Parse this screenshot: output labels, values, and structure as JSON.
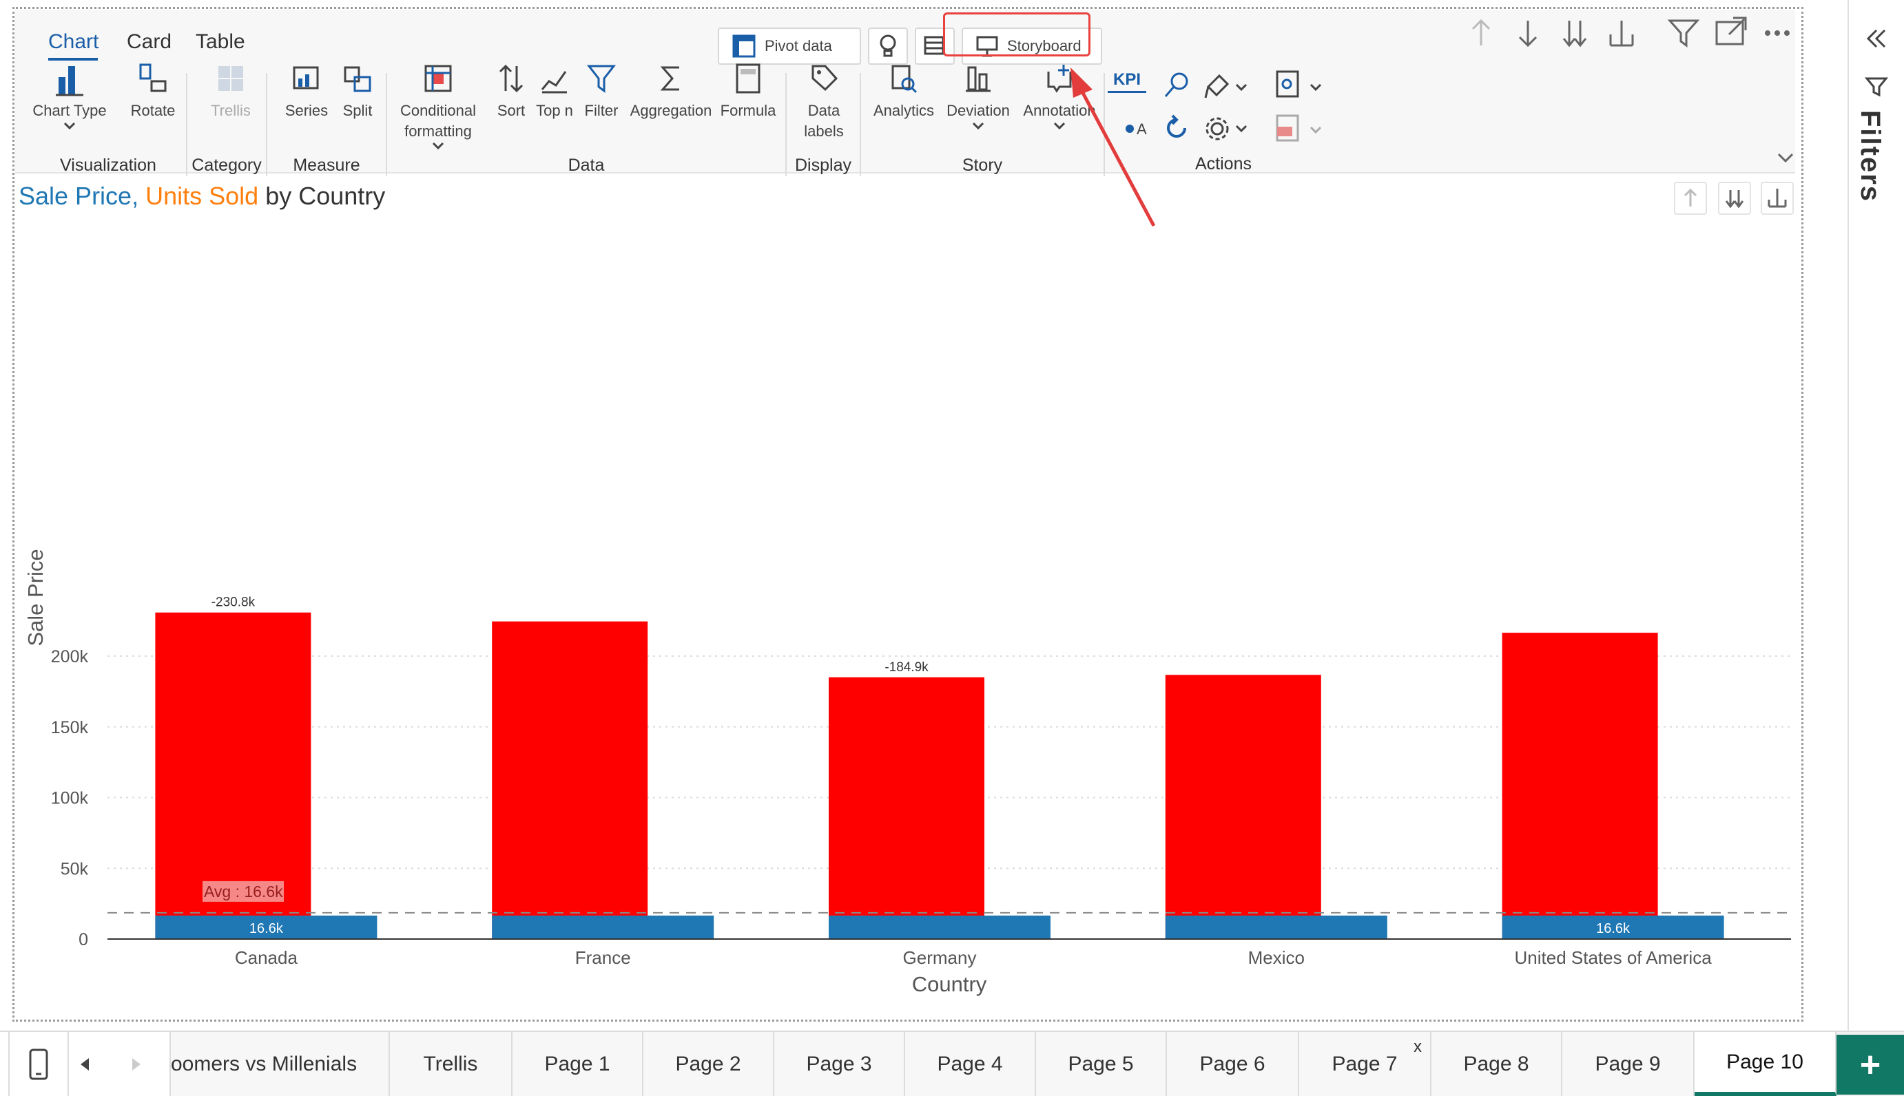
{
  "tabs": [
    {
      "label": "Chart",
      "active": true
    },
    {
      "label": "Card",
      "active": false
    },
    {
      "label": "Table",
      "active": false
    }
  ],
  "top_buttons": {
    "pivot_data": "Pivot data",
    "storyboard": "Storyboard"
  },
  "toolbar": {
    "chart_type": "Chart Type",
    "rotate": "Rotate",
    "trellis": "Trellis",
    "series": "Series",
    "split": "Split",
    "conditional_formatting": [
      "Conditional",
      "formatting"
    ],
    "sort": "Sort",
    "top_n": "Top n",
    "filter": "Filter",
    "aggregation": "Aggregation",
    "formula": "Formula",
    "data_labels": [
      "Data",
      "labels"
    ],
    "analytics": "Analytics",
    "deviation": "Deviation",
    "annotation": "Annotation",
    "kpi": "KPI",
    "groups": {
      "visualization": "Visualization",
      "category": "Category",
      "measure": "Measure",
      "data": "Data",
      "display": "Display",
      "story": "Story",
      "actions": "Actions"
    }
  },
  "chart_data": {
    "type": "bar",
    "title_parts": [
      "Sale Price,",
      "Units Sold",
      "by Country"
    ],
    "xlabel": "Country",
    "ylabel": "Sale Price",
    "categories": [
      "Canada",
      "France",
      "Germany",
      "Mexico",
      "United States of America"
    ],
    "series": [
      {
        "name": "Sale Price",
        "color": "#ff0000",
        "values": [
          230800,
          224500,
          185000,
          186700,
          216500
        ]
      },
      {
        "name": "Units Sold",
        "color": "#1f77b4",
        "values": [
          16600,
          16600,
          16600,
          16600,
          16600
        ]
      }
    ],
    "data_labels": [
      {
        "series": "Sale Price",
        "index": 0,
        "text": "-230.8k"
      },
      {
        "series": "Sale Price",
        "index": 2,
        "text": "-184.9k"
      },
      {
        "series": "Units Sold",
        "index": 0,
        "text": "16.6k"
      },
      {
        "series": "Units Sold",
        "index": 4,
        "text": "16.6k"
      }
    ],
    "yticks": [
      {
        "value": 0,
        "label": "0"
      },
      {
        "value": 50000,
        "label": "50k"
      },
      {
        "value": 100000,
        "label": "100k"
      },
      {
        "value": 150000,
        "label": "150k"
      },
      {
        "value": 200000,
        "label": "200k"
      }
    ],
    "ylim": [
      0,
      240000
    ],
    "average": {
      "value": 16600,
      "label": "Avg : 16.6k"
    },
    "grid": true
  },
  "page_tabs": [
    {
      "label": "oomers vs Millenials",
      "active": false
    },
    {
      "label": "Trellis",
      "active": false
    },
    {
      "label": "Page 1",
      "active": false
    },
    {
      "label": "Page 2",
      "active": false
    },
    {
      "label": "Page 3",
      "active": false
    },
    {
      "label": "Page 4",
      "active": false
    },
    {
      "label": "Page 5",
      "active": false
    },
    {
      "label": "Page 6",
      "active": false
    },
    {
      "label": "Page 7",
      "active": false
    },
    {
      "label": "Page 8",
      "active": false
    },
    {
      "label": "Page 9",
      "active": false
    },
    {
      "label": "Page 10",
      "active": true
    }
  ],
  "filters_panel": {
    "label": "Filters"
  },
  "page7_close": "x",
  "add_page": "+"
}
